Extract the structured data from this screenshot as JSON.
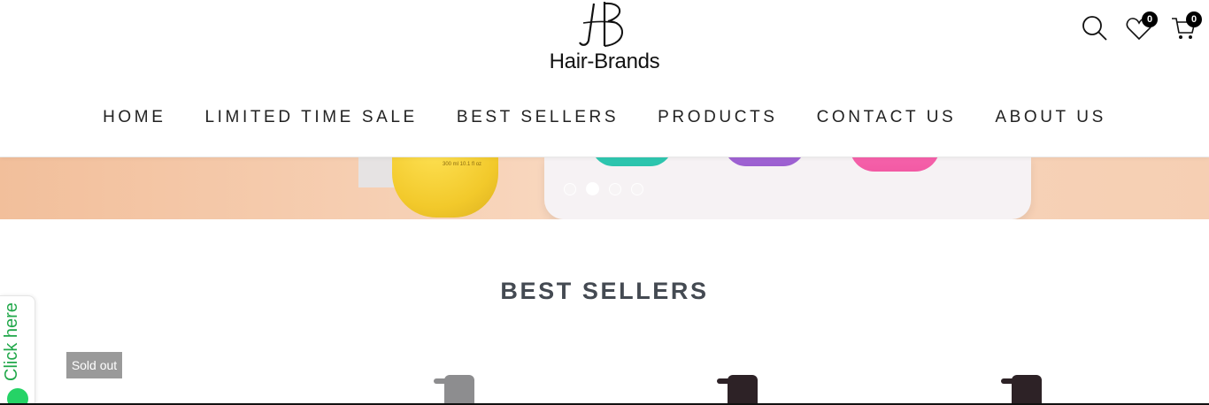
{
  "brand": {
    "logo_text": "Hair-Brands",
    "logo_mark": "HB monogram"
  },
  "header": {
    "icons": [
      "search-icon",
      "heart-icon",
      "cart-icon"
    ],
    "wishlist_count": "0",
    "cart_count": "0"
  },
  "nav": {
    "items": [
      "HOME",
      "LIMITED TIME SALE",
      "BEST SELLERS",
      "PRODUCTS",
      "CONTACT US",
      "ABOUT US"
    ]
  },
  "banner": {
    "slide_dots": 4,
    "active_slide": 2,
    "bottle_label": "300 ml 10.1 fl oz"
  },
  "best_sellers": {
    "title": "BEST SELLERS",
    "badge": "Sold out"
  },
  "chat_tab": {
    "label": "Click here",
    "icon": "whatsapp-icon"
  },
  "colors": {
    "banner_peach": "#f4c7a6",
    "nav_text": "#222222",
    "title_text": "#444a52",
    "soldout_bg": "#9a9a9a",
    "whatsapp_green": "#25d366"
  }
}
